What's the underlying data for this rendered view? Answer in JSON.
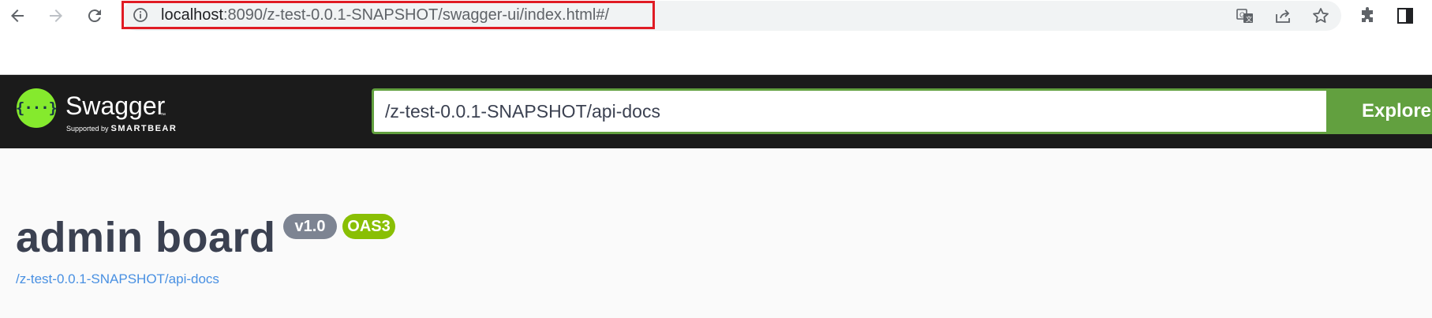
{
  "browser": {
    "url_host": "localhost",
    "url_rest": ":8090/z-test-0.0.1-SNAPSHOT/swagger-ui/index.html#/",
    "icons": {
      "back": "back-arrow-icon",
      "forward": "forward-arrow-icon",
      "reload": "reload-icon",
      "site_info": "info-icon",
      "translate": "translate-icon",
      "share": "share-icon",
      "bookmark": "star-icon",
      "extensions": "puzzle-icon",
      "side_panel": "side-panel-icon"
    },
    "highlight_color": "#e01b24"
  },
  "topbar": {
    "logo_symbol": "{···}",
    "logo_text": "Swagger",
    "logo_tm": "™",
    "supported_by": "Supported by",
    "smartbear": "SMARTBEAR",
    "spec_url_value": "/z-test-0.0.1-SNAPSHOT/api-docs",
    "explore_label": "Explore",
    "accent_color": "#62a03f"
  },
  "info": {
    "title": "admin board",
    "version": "v1.0",
    "oas_badge": "OAS3",
    "spec_link": "/z-test-0.0.1-SNAPSHOT/api-docs"
  }
}
